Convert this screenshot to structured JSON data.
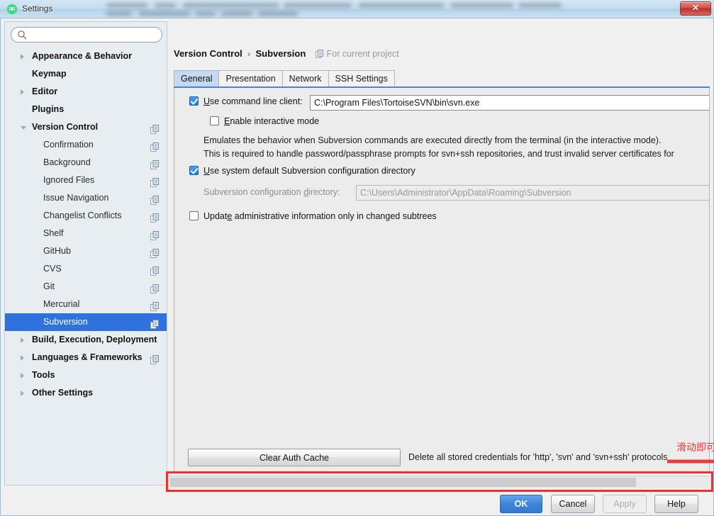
{
  "window": {
    "title": "Settings",
    "app_icon": "android-studio-icon",
    "close_label": "✕"
  },
  "sidebar": {
    "search": {
      "value": "",
      "placeholder": "",
      "icon": "search-icon"
    },
    "items": [
      {
        "label": "Appearance & Behavior",
        "level": 0,
        "arrow": "collapsed",
        "copy": false,
        "selected": false
      },
      {
        "label": "Keymap",
        "level": 0,
        "arrow": "none",
        "copy": false,
        "selected": false
      },
      {
        "label": "Editor",
        "level": 0,
        "arrow": "collapsed",
        "copy": false,
        "selected": false
      },
      {
        "label": "Plugins",
        "level": 0,
        "arrow": "none",
        "copy": false,
        "selected": false
      },
      {
        "label": "Version Control",
        "level": 0,
        "arrow": "expanded",
        "copy": true,
        "selected": false
      },
      {
        "label": "Confirmation",
        "level": 1,
        "arrow": "none",
        "copy": true,
        "selected": false
      },
      {
        "label": "Background",
        "level": 1,
        "arrow": "none",
        "copy": true,
        "selected": false
      },
      {
        "label": "Ignored Files",
        "level": 1,
        "arrow": "none",
        "copy": true,
        "selected": false
      },
      {
        "label": "Issue Navigation",
        "level": 1,
        "arrow": "none",
        "copy": true,
        "selected": false
      },
      {
        "label": "Changelist Conflicts",
        "level": 1,
        "arrow": "none",
        "copy": true,
        "selected": false
      },
      {
        "label": "Shelf",
        "level": 1,
        "arrow": "none",
        "copy": true,
        "selected": false
      },
      {
        "label": "GitHub",
        "level": 1,
        "arrow": "none",
        "copy": true,
        "selected": false
      },
      {
        "label": "CVS",
        "level": 1,
        "arrow": "none",
        "copy": true,
        "selected": false
      },
      {
        "label": "Git",
        "level": 1,
        "arrow": "none",
        "copy": true,
        "selected": false
      },
      {
        "label": "Mercurial",
        "level": 1,
        "arrow": "none",
        "copy": true,
        "selected": false
      },
      {
        "label": "Subversion",
        "level": 1,
        "arrow": "none",
        "copy": true,
        "selected": true
      },
      {
        "label": "Build, Execution, Deployment",
        "level": 0,
        "arrow": "collapsed",
        "copy": false,
        "selected": false
      },
      {
        "label": "Languages & Frameworks",
        "level": 0,
        "arrow": "collapsed",
        "copy": true,
        "selected": false
      },
      {
        "label": "Tools",
        "level": 0,
        "arrow": "collapsed",
        "copy": false,
        "selected": false
      },
      {
        "label": "Other Settings",
        "level": 0,
        "arrow": "collapsed",
        "copy": false,
        "selected": false
      }
    ]
  },
  "breadcrumb": {
    "parent": "Version Control",
    "separator": "›",
    "current": "Subversion",
    "scope": "For current project",
    "scope_icon": "copy-icon"
  },
  "tabs": [
    {
      "label": "General",
      "active": true
    },
    {
      "label": "Presentation",
      "active": false
    },
    {
      "label": "Network",
      "active": false
    },
    {
      "label": "SSH Settings",
      "active": false
    }
  ],
  "form": {
    "use_command_line_client": {
      "label": "Use command line client:",
      "checked": true,
      "value": "C:\\Program Files\\TortoiseSVN\\bin\\svn.exe"
    },
    "enable_interactive_mode": {
      "label": "Enable interactive mode",
      "checked": false
    },
    "description_line1": "Emulates the behavior when Subversion commands are executed directly from the terminal (in the interactive mode).",
    "description_line2": "This is required to handle password/passphrase prompts for svn+ssh repositories, and trust invalid server certificates for",
    "use_system_default_config": {
      "label": "Use system default Subversion configuration directory",
      "checked": true
    },
    "config_directory": {
      "label": "Subversion configuration directory:",
      "value": "C:\\Users\\Administrator\\AppData\\Roaming\\Subversion",
      "disabled": true
    },
    "update_admin_info": {
      "label": "Update administrative information only in changed subtrees",
      "checked": false
    },
    "clear_auth_cache": {
      "button_label": "Clear Auth Cache",
      "description": "Delete all stored credentials for 'http', 'svn' and 'svn+ssh' protocols"
    }
  },
  "annotation": {
    "text": "滑动即可",
    "color": "#ec3b3b",
    "arrow": "right-arrow-icon",
    "highlight_target": "horizontal-scrollbar"
  },
  "scrollbar": {
    "orientation": "horizontal",
    "thumb_fraction": 0.86
  },
  "buttons": {
    "ok": "OK",
    "cancel": "Cancel",
    "apply": "Apply",
    "apply_disabled": true,
    "help": "Help"
  }
}
